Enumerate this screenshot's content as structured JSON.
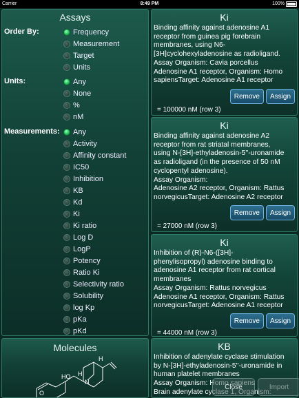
{
  "status_bar": {
    "carrier": "Carrier",
    "time": "8:49 PM",
    "battery": "100%"
  },
  "assays": {
    "title": "Assays",
    "order_by": {
      "label": "Order By:",
      "options": [
        "Frequency",
        "Measurement",
        "Target",
        "Units"
      ],
      "selected": "Frequency"
    },
    "units": {
      "label": "Units:",
      "options": [
        "Any",
        "None",
        "%",
        "nM"
      ],
      "selected": "Any"
    },
    "measurements": {
      "label": "Measurements:",
      "options": [
        "Any",
        "Activity",
        "Affinity constant",
        "IC50",
        "Inhibition",
        "KB",
        "Kd",
        "Ki",
        "Ki ratio",
        "Log D",
        "LogP",
        "Potency",
        "Ratio Ki",
        "Selectivity ratio",
        "Solubility",
        "log Kp",
        "pKa",
        "pKd"
      ],
      "selected": "Any"
    }
  },
  "molecules": {
    "title": "Molecules",
    "atom_labels": [
      "HO",
      "H",
      "N",
      "H",
      "O"
    ]
  },
  "results": [
    {
      "title": "Ki",
      "desc": [
        "Binding affinity against adenosine A1",
        "receptor from guinea pig forebrain",
        "membranes, using N6-",
        "[3H]cyclohexyladenosine as radioligand.",
        "Assay Organism: Cavia porcellus",
        "Adenosine A1 receptor, Organism: Homo",
        "sapiensTarget: Adenosine A1 receptor"
      ],
      "value": "= 100000 nM (row 3)",
      "remove_label": "Remove",
      "assign_label": "Assign"
    },
    {
      "title": "Ki",
      "desc": [
        "Binding affinity against adenosine A2",
        "receptor from rat striatal membranes,",
        "using N-[3H]-ethyladenosin-5''-uronamide",
        "as radioligand (in the presence of 50 nM",
        "cyclopentyl adenosine).",
        "Assay Organism:",
        "Adenosine A2 receptor, Organism: Rattus",
        "norvegicusTarget: Adenosine A2 receptor"
      ],
      "value": "= 27000 nM (row 3)",
      "remove_label": "Remove",
      "assign_label": "Assign"
    },
    {
      "title": "Ki",
      "desc": [
        "Inhibition of (R)-N6-([3H]-",
        "phenylisopropyl) adenosine binding to",
        "adenosine A1 receptor from rat cortical",
        "membranes",
        "Assay Organism: Rattus norvegicus",
        "Adenosine A1 receptor, Organism: Rattus",
        "norvegicusTarget: Adenosine A1 receptor"
      ],
      "value": "= 44000 nM (row 3)",
      "remove_label": "Remove",
      "assign_label": "Assign"
    },
    {
      "title": "KB",
      "desc": [
        "Inhibition of adenylate cyclase stimulation",
        "by N-[3H]-ethyladenosin-5''-uronamide in",
        "human platelet membranes",
        "Assay Organism: Homo sapiens",
        "Brain adenylate cyclase 1, Organism:"
      ]
    }
  ],
  "footer": {
    "close_label": "Close",
    "import_label": "Import"
  }
}
